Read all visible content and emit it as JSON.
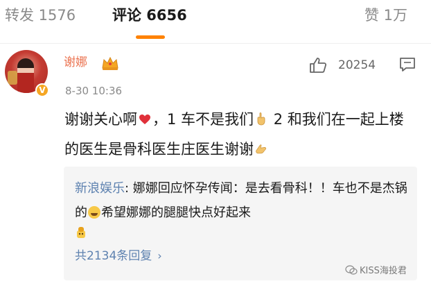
{
  "tabs": {
    "repost": "转发 1576",
    "comment": "评论 6656",
    "like": "赞 1万"
  },
  "comment": {
    "username": "谢娜",
    "timestamp": "8-30 10:36",
    "like_count": "20254",
    "text_part1": "谢谢关心啊",
    "text_part2": "，1 车不是我们",
    "text_part3": " 2 和我们在一起上楼的医生是骨科医生庄医生谢谢"
  },
  "reply": {
    "author": "新浪娱乐",
    "text_part1": ": 娜娜回应怀孕传闻：是去看骨科！！车也不是杰锅的",
    "text_part2": "希望娜娜的腿腿快点好起来",
    "more_link": "共2134条回复"
  },
  "watermark": {
    "text": "KISS海投君"
  },
  "colors": {
    "accent_orange": "#ff8200",
    "username_color": "#eb7350",
    "link_blue": "#5e82b0"
  }
}
